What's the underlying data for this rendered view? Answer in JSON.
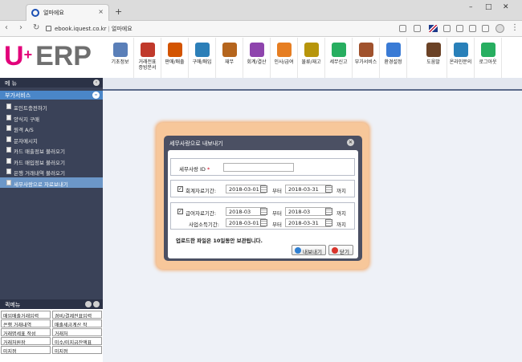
{
  "browser": {
    "tab_title": "얼마에요",
    "tab_close": "×",
    "new_tab": "+",
    "url_host": "ebook.iquest.co.kr",
    "url_sep": "|",
    "url_title": "얼마에요",
    "back": "‹",
    "forward": "›",
    "reload": "↻",
    "menu": "⋮",
    "minimize": "–",
    "maximize": "□",
    "close": "✕"
  },
  "logo": {
    "u": "U",
    "plus": "+",
    "erp": "ERP"
  },
  "menu": [
    {
      "label": "기초정보",
      "color": "#5a7fb8",
      "icon": "basic-info-icon"
    },
    {
      "label": "거래전표\n증빙문서",
      "color": "#c0392b",
      "icon": "voucher-icon"
    },
    {
      "label": "판매/매출",
      "color": "#d35400",
      "icon": "sales-icon"
    },
    {
      "label": "구매/매입",
      "color": "#2c7fb8",
      "icon": "purchase-icon"
    },
    {
      "label": "재무",
      "color": "#b5651d",
      "icon": "finance-icon"
    },
    {
      "label": "회계/결산",
      "color": "#8e44ad",
      "icon": "accounting-icon"
    },
    {
      "label": "인사/급여",
      "color": "#e67e22",
      "icon": "hr-icon"
    },
    {
      "label": "물류/재고",
      "color": "#b7950b",
      "icon": "logistics-icon"
    },
    {
      "label": "세무신고",
      "color": "#27ae60",
      "icon": "tax-icon"
    },
    {
      "label": "부가서비스",
      "color": "#a0522d",
      "icon": "addon-icon"
    },
    {
      "label": "환경설정",
      "color": "#3a7bd5",
      "icon": "settings-icon"
    }
  ],
  "menu_right": [
    {
      "label": "도움말",
      "color": "#6b4226",
      "icon": "help-icon"
    },
    {
      "label": "온라인문의",
      "color": "#2980b9",
      "icon": "online-inquiry-icon"
    },
    {
      "label": "로그아웃",
      "color": "#27ae60",
      "icon": "logout-icon"
    }
  ],
  "sidebar": {
    "header": "메 뉴",
    "header_toggle": "‹",
    "section": "부가서비스",
    "section_toggle": "–",
    "items": [
      "포인트충전하기",
      "양식지 구매",
      "원격 A/S",
      "문자메시지",
      "카드 매출정보 불러오기",
      "카드 매입정보 불러오기",
      "은행 거래내역 불러오기",
      "세무사랑으로 자료보내기"
    ],
    "active_index": 7
  },
  "favorites": {
    "header": "퀵메뉴",
    "items": [
      "매입매출거래입력",
      "경비/결제전표입력",
      "은행 거래내역",
      "매출세금계산 작",
      "거래명세표 작성",
      "거래처",
      "거래처원장",
      "미수/미지급잔액표",
      "미지정",
      "미지정"
    ]
  },
  "dialog": {
    "title": "세무사랑으로 내보내기",
    "close": "✕",
    "taxid_label": "세무사랑 ID",
    "required": "*",
    "taxid_value": "",
    "accounting_label": "회계자료기간:",
    "accounting_from": "2018-03-01",
    "accounting_to": "2018-03-31",
    "from_word": "부터",
    "to_word": "까지",
    "payroll_label": "급여자료기간:",
    "payroll_from": "2018-03",
    "payroll_to": "2018-03",
    "business_label": "사업소득기간:",
    "business_from": "2018-03-01",
    "business_to": "2018-03-31",
    "check_mark": "✓",
    "note": "업로드한 파일은 10일동안 보관됩니다.",
    "export_button": "내보내기",
    "close_button": "닫기"
  }
}
